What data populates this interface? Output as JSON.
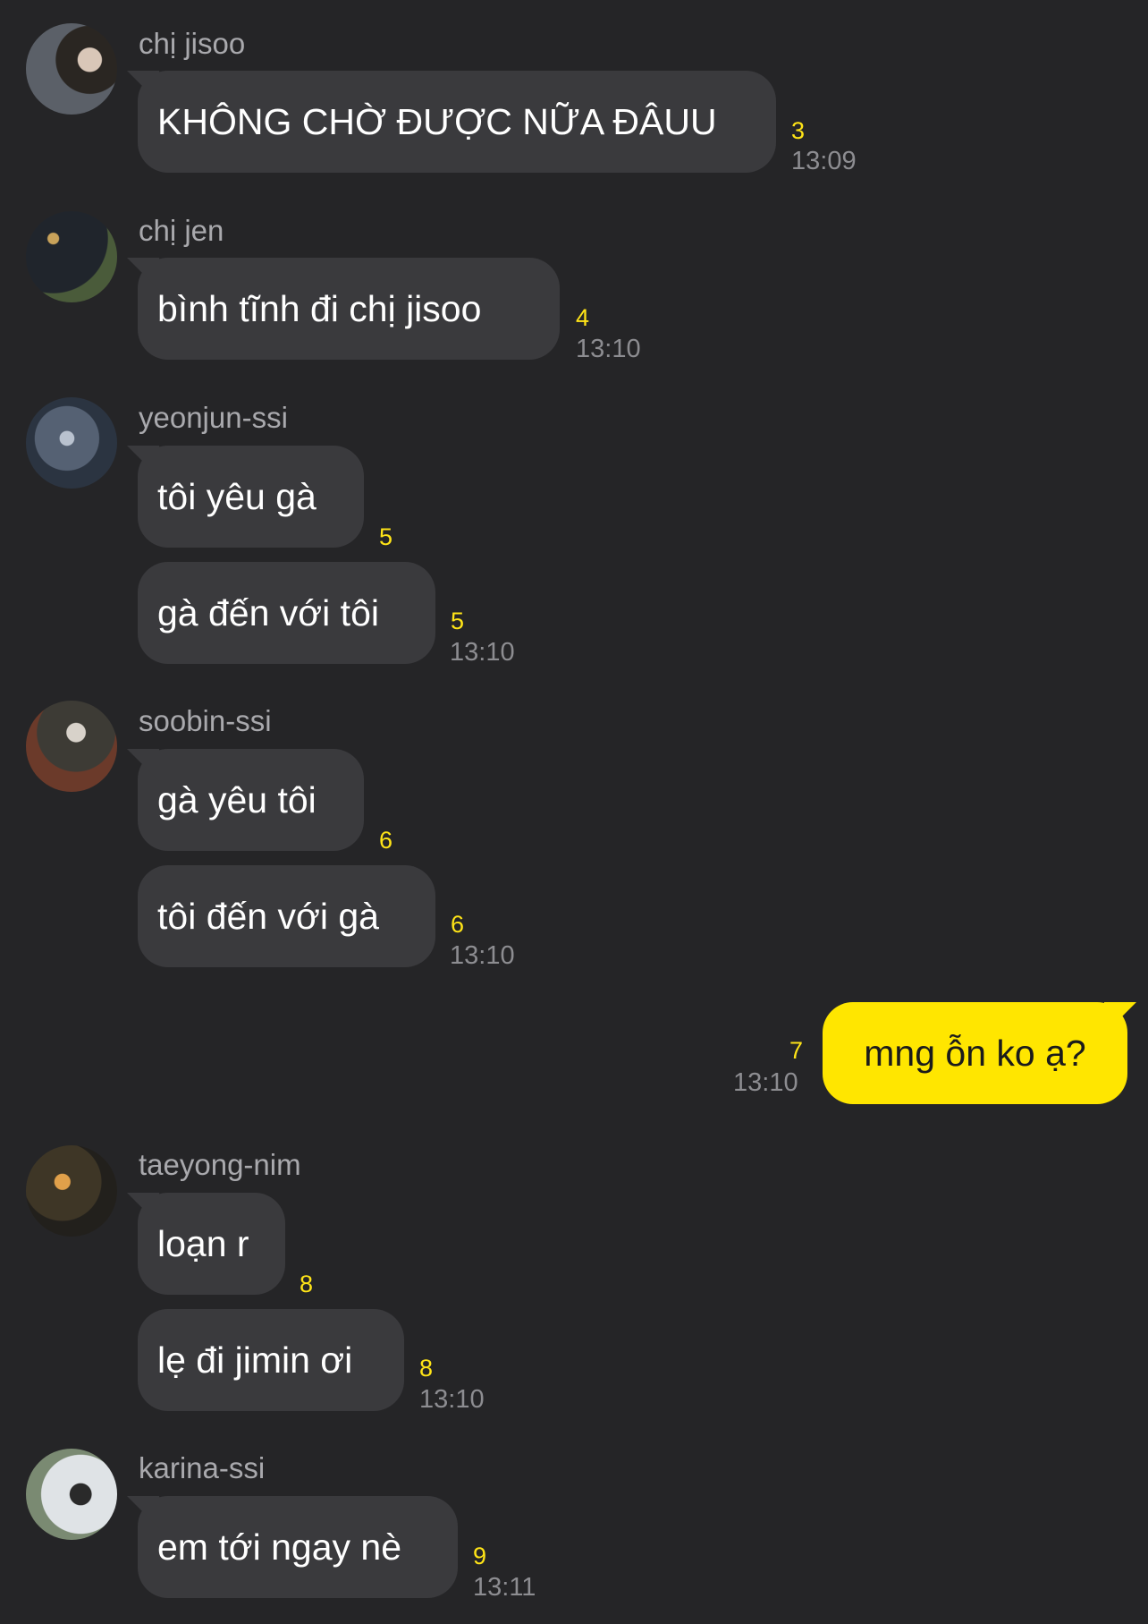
{
  "messages": [
    {
      "sender": "chị jisoo",
      "bubbles": [
        {
          "text": "KHÔNG CHỜ ĐƯỢC NỮA ĐÂUU",
          "count": "3"
        }
      ],
      "time": "13:09"
    },
    {
      "sender": "chị jen",
      "bubbles": [
        {
          "text": "bình tĩnh đi chị jisoo",
          "count": "4"
        }
      ],
      "time": "13:10"
    },
    {
      "sender": "yeonjun-ssi",
      "bubbles": [
        {
          "text": "tôi yêu gà",
          "count": "5"
        },
        {
          "text": "gà đến với tôi",
          "count": "5"
        }
      ],
      "time": "13:10"
    },
    {
      "sender": "soobin-ssi",
      "bubbles": [
        {
          "text": "gà yêu tôi",
          "count": "6"
        },
        {
          "text": "tôi đến với gà",
          "count": "6"
        }
      ],
      "time": "13:10"
    },
    {
      "sender": "taeyong-nim",
      "bubbles": [
        {
          "text": "loạn r",
          "count": "8"
        },
        {
          "text": "lẹ đi jimin ơi",
          "count": "8"
        }
      ],
      "time": "13:10"
    },
    {
      "sender": "karina-ssi",
      "bubbles": [
        {
          "text": "em tới ngay nè",
          "count": "9"
        }
      ],
      "time": "13:11"
    }
  ],
  "my_message": {
    "text": "mng ỗn ko ạ?",
    "count": "7",
    "time": "13:10"
  },
  "colors": {
    "background": "#252527",
    "bubble": "#3a3a3d",
    "my_bubble": "#ffe600",
    "unread_count": "#ffe417",
    "timestamp": "#8d8d91"
  }
}
